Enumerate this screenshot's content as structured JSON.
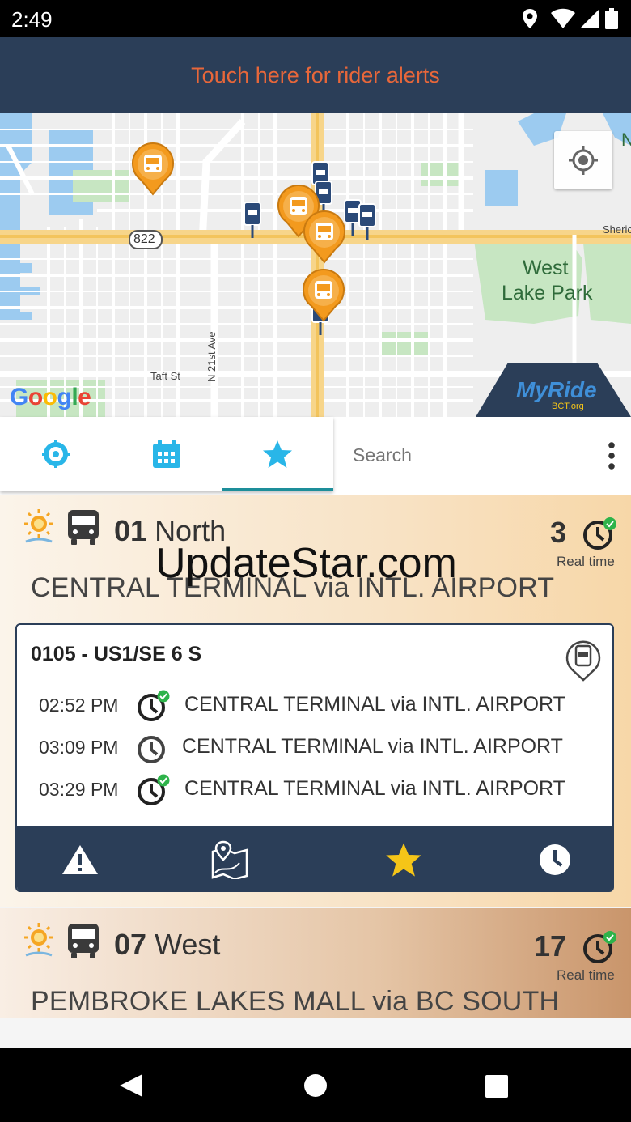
{
  "status_bar": {
    "time": "2:49",
    "icons": [
      "location-icon",
      "wifi-icon",
      "signal-icon",
      "battery-icon"
    ]
  },
  "alert_bar": {
    "text": "Touch here for rider alerts"
  },
  "map": {
    "labels": {
      "highway": "822",
      "street_vertical": "N 21st Ave",
      "street_taft": "Taft St",
      "park_line1": "West",
      "park_line2": "Lake Park",
      "edge_label": "Sheric",
      "edge_n": "N"
    },
    "google_logo": "Google",
    "brand_logo": "MyRide",
    "brand_sub": "BCT.org"
  },
  "tabs": {
    "items": [
      {
        "name": "nearby",
        "icon": "target-icon"
      },
      {
        "name": "schedule",
        "icon": "calendar-icon"
      },
      {
        "name": "favorites",
        "icon": "star-icon",
        "active": true
      }
    ],
    "search_placeholder": "Search"
  },
  "routes": [
    {
      "number": "01",
      "direction": "North",
      "destination": "CENTRAL TERMINAL via INTL. AIRPORT",
      "realtime_count": "3",
      "realtime_label": "Real time",
      "stop": {
        "title": "0105 - US1/SE 6 S",
        "arrivals": [
          {
            "time": "02:52 PM",
            "destination": "CENTRAL TERMINAL via INTL. AIRPORT",
            "realtime": true
          },
          {
            "time": "03:09 PM",
            "destination": "CENTRAL TERMINAL via INTL. AIRPORT",
            "realtime": false
          },
          {
            "time": "03:29 PM",
            "destination": "CENTRAL TERMINAL via INTL. AIRPORT",
            "realtime": true
          }
        ]
      },
      "actions": [
        "alert-icon",
        "map-icon",
        "star-icon",
        "clock-icon"
      ]
    },
    {
      "number": "07",
      "direction": "West",
      "destination": "PEMBROKE LAKES MALL via BC SOUTH",
      "realtime_count": "17",
      "realtime_label": "Real time"
    }
  ],
  "watermark": "UpdateStar.com",
  "colors": {
    "header_navy": "#2b3e58",
    "alert_orange": "#e8673a",
    "tab_accent": "#29b6e8",
    "indicator": "#1d8e9a",
    "fav_star": "#f5c518",
    "realtime_green": "#2eb34a",
    "bus_marker": "#f39a1e"
  }
}
